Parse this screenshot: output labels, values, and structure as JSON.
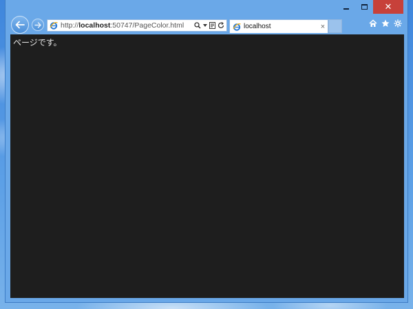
{
  "browser": {
    "address": {
      "scheme": "http://",
      "host": "localhost",
      "rest": ":50747/PageColor.html"
    },
    "tab": {
      "title": "localhost",
      "close_glyph": "×"
    },
    "caption": {
      "close_glyph": "✕"
    },
    "icons": {
      "back": "back-arrow-icon",
      "forward": "forward-arrow-icon",
      "home": "home-icon",
      "favorites": "star-icon",
      "tools": "gear-icon"
    }
  },
  "page": {
    "text": "ページです。",
    "background": "#1e1e1e",
    "foreground": "#e8e8e8"
  }
}
